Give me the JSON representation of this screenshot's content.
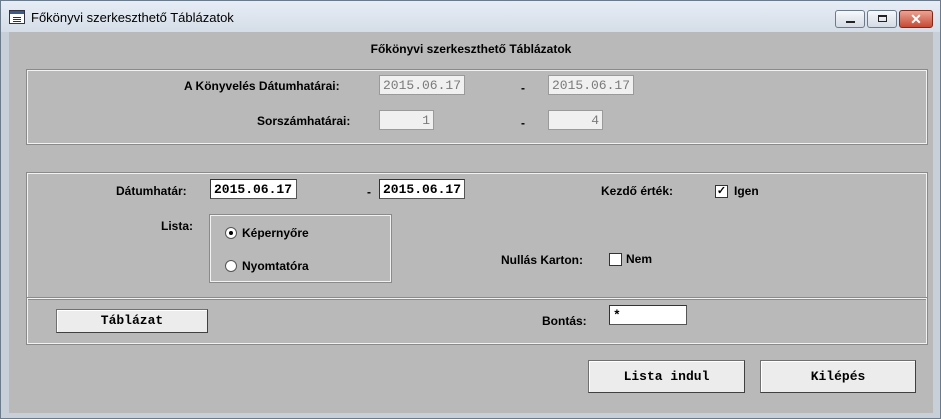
{
  "window": {
    "title": "Főkönyvi szerkeszthető Táblázatok"
  },
  "form": {
    "header": "Főkönyvi szerkeszthető Táblázatok",
    "konyveles_label": "A Könyvelés  Dátumhatárai:",
    "konyveles_from": "2015.06.17",
    "konyveles_to": "2015.06.17",
    "sorszam_label": "Sorszámhatárai:",
    "sorszam_from": "1",
    "sorszam_to": "4",
    "separator": "-",
    "datumhatar_label": "Dátumhatár:",
    "datumhatar_from": "2015.06.17",
    "datumhatar_to": "2015.06.17",
    "kezdo_label": "Kezdő érték:",
    "kezdo_option": "Igen",
    "kezdo_checked": true,
    "lista_label": "Lista:",
    "lista_options": [
      "Képernyőre",
      "Nyomtatóra"
    ],
    "lista_selected": "Képernyőre",
    "nullas_label": "Nullás Karton:",
    "nullas_option": "Nem",
    "nullas_checked": false,
    "bontas_label": "Bontás:",
    "bontas_value": "*"
  },
  "buttons": {
    "tablazat": "Táblázat",
    "lista_indul": "Lista indul",
    "kilepes": "Kilépés"
  },
  "icons": {
    "app": "form-window-icon",
    "minimize": "minimize-icon",
    "maximize": "maximize-icon",
    "close": "close-icon"
  }
}
